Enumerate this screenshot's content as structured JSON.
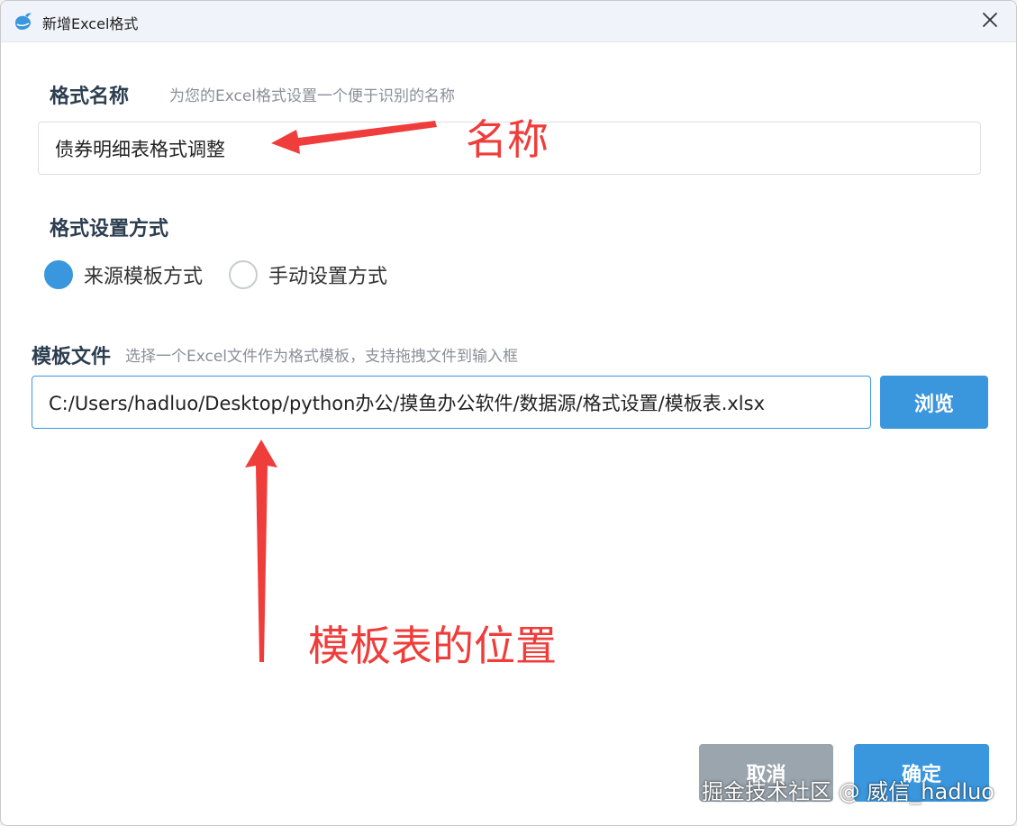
{
  "window": {
    "title": "新增Excel格式",
    "app_icon": "whale-icon",
    "close_icon": "close-icon"
  },
  "format_name": {
    "label": "格式名称",
    "hint": "为您的Excel格式设置一个便于识别的名称",
    "value": "债券明细表格式调整"
  },
  "format_mode": {
    "label": "格式设置方式",
    "options": [
      {
        "label": "来源模板方式",
        "selected": true
      },
      {
        "label": "手动设置方式",
        "selected": false
      }
    ]
  },
  "template_file": {
    "label": "模板文件",
    "hint": "选择一个Excel文件作为格式模板，支持拖拽文件到输入框",
    "path": "C:/Users/hadluo/Desktop/python办公/摸鱼办公软件/数据源/格式设置/模板表.xlsx",
    "browse_label": "浏览"
  },
  "footer": {
    "cancel_label": "取消",
    "confirm_label": "确定"
  },
  "annotations": {
    "name_note": "名称",
    "template_note": "模板表的位置"
  },
  "watermark": "掘金技术社区 @ 威信_hadluo",
  "colors": {
    "accent": "#3a96dd",
    "cancel": "#9aa5ae",
    "annotation": "#ef3d3b",
    "titlebar": "#f0f3f9"
  }
}
